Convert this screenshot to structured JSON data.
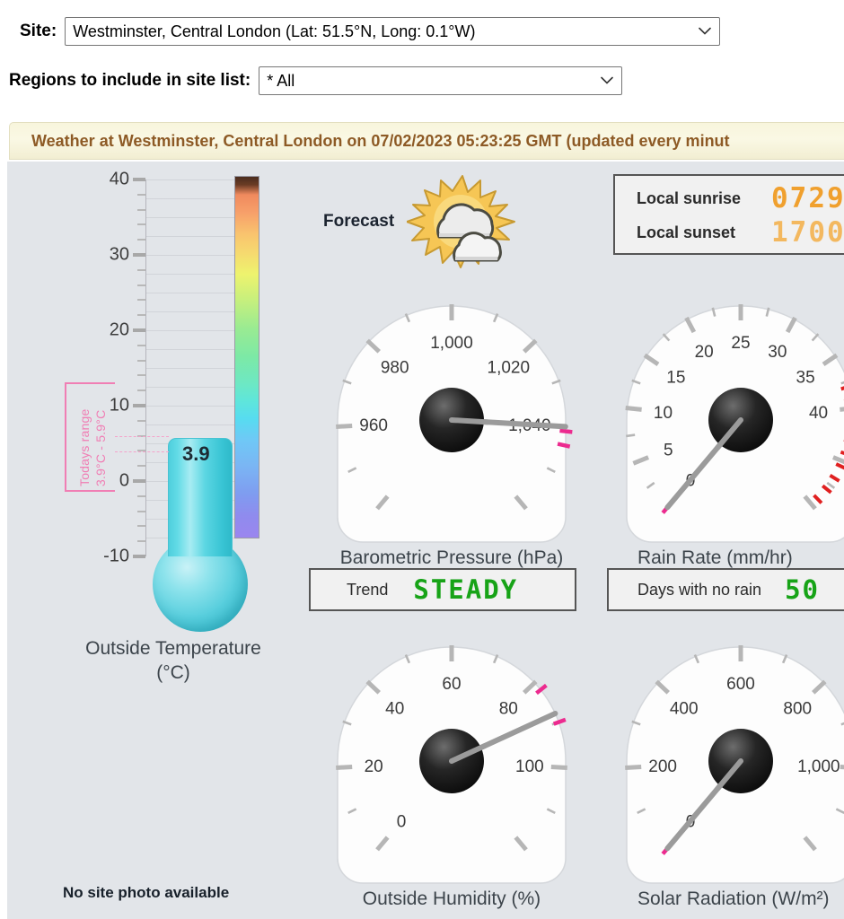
{
  "form": {
    "site_label": "Site:",
    "site_value": "Westminster, Central London (Lat: 51.5°N, Long: 0.1°W)",
    "region_label": "Regions to include in site list:",
    "region_value": "* All"
  },
  "banner": {
    "text": "Weather at Westminster, Central London on 07/02/2023 05:23:25 GMT (updated every minut"
  },
  "thermometer": {
    "value": "3.9",
    "caption_line1": "Outside Temperature",
    "caption_line2": "(°C)",
    "range_line1": "Todays range",
    "range_line2": "3.9°C - 5.9°C",
    "ticks": [
      "40",
      "30",
      "20",
      "10",
      "0",
      "-10"
    ],
    "range_min": 3.9,
    "range_max": 5.9,
    "scale_min": -10,
    "scale_max": 40
  },
  "forecast": {
    "label": "Forecast",
    "icon": "sun-behind-clouds-icon"
  },
  "sun": {
    "sunrise_label": "Local sunrise",
    "sunrise_value": "0729",
    "sunset_label": "Local sunset",
    "sunset_value": "1700"
  },
  "photo": {
    "no_photo_text": "No site photo available"
  },
  "readouts": [
    {
      "name": "trend",
      "label": "Trend",
      "value": "STEADY"
    },
    {
      "name": "days-no-rain",
      "label": "Days with no rain",
      "value": "50"
    }
  ],
  "chart_data": [
    {
      "type": "gauge",
      "name": "barometric-pressure",
      "title": "Barometric Pressure (hPa)",
      "unit": "hPa",
      "min": 940,
      "max": 1060,
      "value": 1040,
      "tick_labels": [
        "960",
        "980",
        "1,000",
        "1,020",
        "1,040"
      ],
      "tick_values": [
        960,
        980,
        1000,
        1020,
        1040
      ],
      "marker_color": "#ec2b8f",
      "markers": [
        1041,
        1044
      ]
    },
    {
      "type": "gauge",
      "name": "rain-rate",
      "title": "Rain Rate (mm/hr)",
      "unit": "mm/hr",
      "min": 0,
      "max": 50,
      "value": 0,
      "tick_labels": [
        "0",
        "5",
        "10",
        "15",
        "20",
        "25",
        "30",
        "35",
        "40"
      ],
      "tick_values": [
        0,
        5,
        10,
        15,
        20,
        25,
        30,
        35,
        40
      ],
      "marker_color": "#ec2b8f",
      "markers": [
        0
      ],
      "alarm_color": "#e02020",
      "alarm_from": 38
    },
    {
      "type": "gauge",
      "name": "outside-humidity",
      "title": "Outside Humidity (%)",
      "unit": "%",
      "min": 0,
      "max": 120,
      "value": 88,
      "tick_labels": [
        "0",
        "20",
        "40",
        "60",
        "80",
        "100"
      ],
      "tick_values": [
        0,
        20,
        40,
        60,
        80,
        100
      ],
      "marker_color": "#ec2b8f",
      "markers": [
        82,
        90
      ]
    },
    {
      "type": "gauge",
      "name": "solar-radiation",
      "title": "Solar Radiation (W/m²)",
      "unit": "W/m²",
      "min": 0,
      "max": 1200,
      "value": 0,
      "tick_labels": [
        "0",
        "200",
        "400",
        "600",
        "800",
        "1,000"
      ],
      "tick_values": [
        0,
        200,
        400,
        600,
        800,
        1000
      ],
      "marker_color": "#ec2b8f",
      "markers": [
        0
      ]
    }
  ]
}
